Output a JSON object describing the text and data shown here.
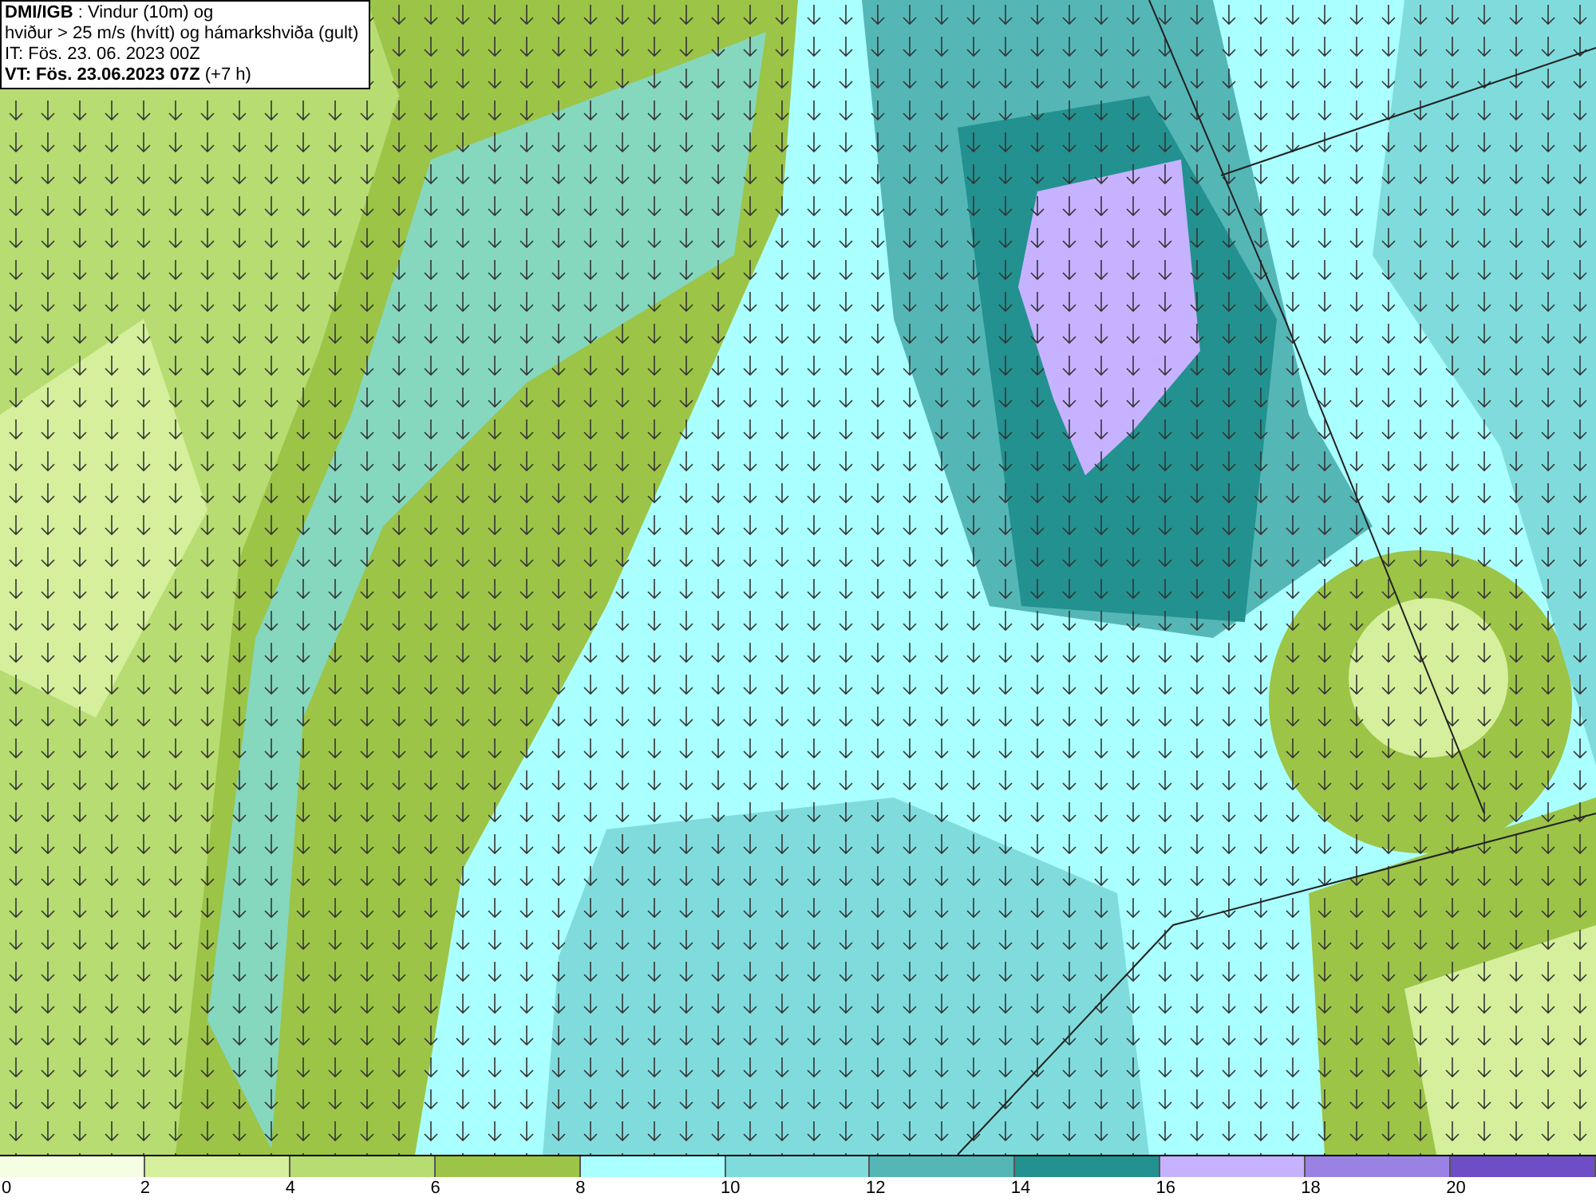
{
  "header": {
    "lines": [
      "**DMI/IGB** : Vindur (10m) og",
      "hviður > 25 m/s (hvítt) og hámarkshviða (gult)",
      "IT: Fös. 23. 06. 2023 00Z",
      "**VT: Fös. 23.06.2023 07Z** (+7 h)"
    ]
  },
  "legend": {
    "bins": [
      {
        "color": "#f5fde2"
      },
      {
        "color": "#d5ef9c"
      },
      {
        "color": "#b6dc72"
      },
      {
        "color": "#9cc447"
      },
      {
        "color": "#aaffff"
      },
      {
        "color": "#80dcdc"
      },
      {
        "color": "#55b6b6"
      },
      {
        "color": "#22918f"
      },
      {
        "color": "#c6b2ff"
      },
      {
        "color": "#9a82e4"
      },
      {
        "color": "#6e4ec6"
      }
    ],
    "labels": [
      "0",
      "2",
      "4",
      "6",
      "8",
      "10",
      "12",
      "14",
      "16",
      "18",
      "20"
    ]
  }
}
